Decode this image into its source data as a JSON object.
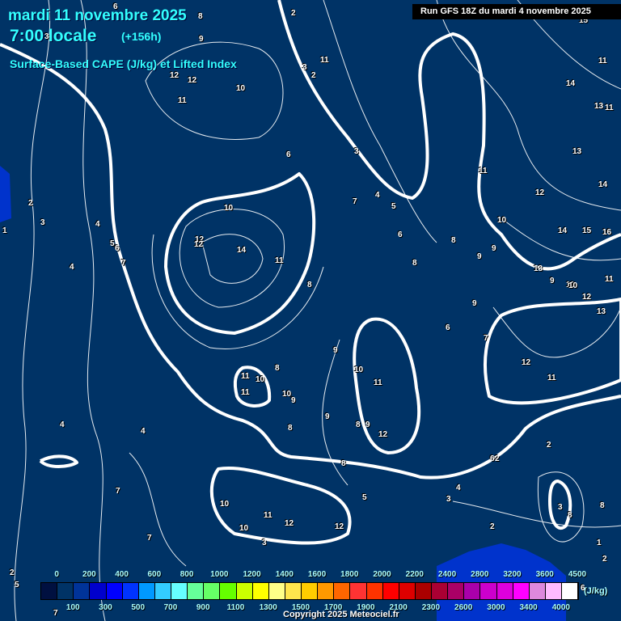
{
  "header": {
    "date": "mardi 11 novembre 2025",
    "time": "7:00 locale",
    "lead": "(+156h)",
    "title": "Surface-Based CAPE (J/kg) et Lifted Index",
    "run": "Run GFS 18Z du mardi 4 novembre 2025"
  },
  "contour_labels": [
    "6",
    "8",
    "2",
    "9",
    "3",
    "11",
    "12",
    "12",
    "10",
    "11",
    "2",
    "3",
    "15",
    "11",
    "11",
    "14",
    "12",
    "6",
    "3",
    "13",
    "11",
    "4",
    "5",
    "14",
    "7",
    "12",
    "10",
    "1",
    "2",
    "3",
    "4",
    "5",
    "6",
    "7",
    "4",
    "14",
    "13",
    "12",
    "11",
    "10",
    "14",
    "15",
    "16",
    "8",
    "6",
    "8",
    "9",
    "13",
    "9",
    "10",
    "11",
    "12",
    "9",
    "8",
    "13",
    "12",
    "7",
    "6",
    "9",
    "11",
    "10",
    "11",
    "10",
    "11",
    "10",
    "9",
    "8",
    "9",
    "9",
    "8",
    "12",
    "4",
    "4",
    "11",
    "10",
    "9",
    "8",
    "7",
    "8",
    "7",
    "10",
    "10",
    "11",
    "12",
    "12",
    "3",
    "6",
    "5",
    "4",
    "3",
    "2",
    "2",
    "3",
    "8",
    "8",
    "2",
    "2",
    "1",
    "2",
    "6",
    "5",
    "7"
  ],
  "legend": {
    "colors": [
      "#001040",
      "#003366",
      "#003399",
      "#0000cc",
      "#0000ff",
      "#0033ff",
      "#0099ff",
      "#33ccff",
      "#66ffff",
      "#66ff99",
      "#66ff66",
      "#66ff00",
      "#ccff00",
      "#ffff00",
      "#ffff88",
      "#ffe64d",
      "#ffcc00",
      "#ff9900",
      "#ff6600",
      "#ff3333",
      "#ff3300",
      "#ff0000",
      "#dd0000",
      "#aa0000",
      "#aa0033",
      "#aa0066",
      "#aa00aa",
      "#cc00cc",
      "#dd00dd",
      "#ff00ff",
      "#dd88dd",
      "#ffbbff",
      "#ffffff"
    ],
    "top_labels": [
      "0",
      "200",
      "400",
      "600",
      "800",
      "1000",
      "1200",
      "1400",
      "1600",
      "1800",
      "2000",
      "2200",
      "2400",
      "2800",
      "3200",
      "3600",
      "4500"
    ],
    "bottom_labels": [
      "100",
      "300",
      "500",
      "700",
      "900",
      "1100",
      "1300",
      "1500",
      "1700",
      "1900",
      "2100",
      "2300",
      "2600",
      "3000",
      "3400",
      "4000"
    ],
    "unit": "(J/kg)"
  },
  "copyright": "Copyright 2025 Meteociel.fr"
}
